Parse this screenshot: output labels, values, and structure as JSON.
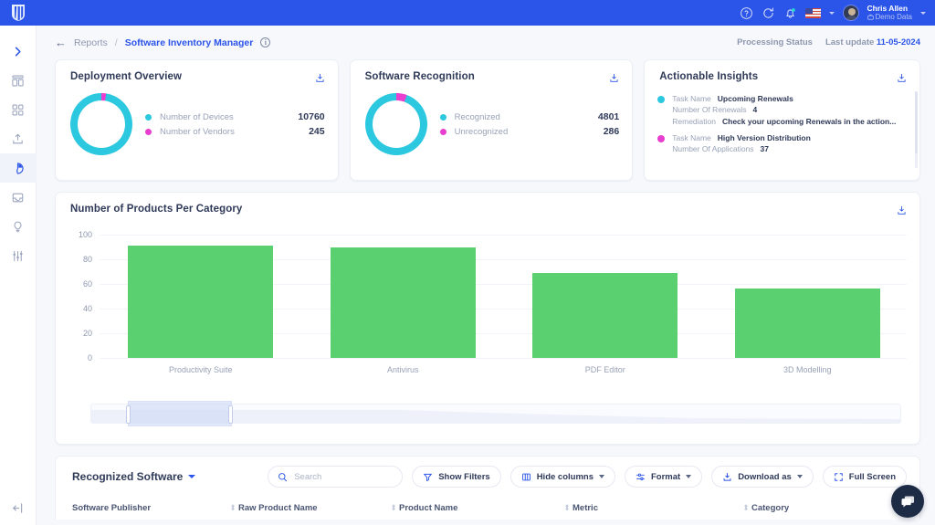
{
  "topbar": {
    "logo_name": "app-logo",
    "icons": [
      "help-icon",
      "history-icon",
      "notification-bell-icon"
    ],
    "flag": "us-flag",
    "user_name": "Chris Allen",
    "user_org": "Demo Data"
  },
  "rail": {
    "expand_label": "expand-sidebar",
    "items": [
      {
        "name": "sidebar-item-dashboard",
        "icon": "dashboard-icon"
      },
      {
        "name": "sidebar-item-apps",
        "icon": "grid-apps-icon"
      },
      {
        "name": "sidebar-item-upload",
        "icon": "upload-icon"
      },
      {
        "name": "sidebar-item-reports",
        "icon": "pie-chart-icon"
      },
      {
        "name": "sidebar-item-inbox",
        "icon": "inbox-icon"
      },
      {
        "name": "sidebar-item-insights",
        "icon": "lightbulb-icon"
      },
      {
        "name": "sidebar-item-settings",
        "icon": "sliders-icon"
      }
    ],
    "collapse": "collapse-sidebar-icon"
  },
  "breadcrumb": {
    "back": "←",
    "parent": "Reports",
    "separator": "/",
    "current": "Software Inventory Manager",
    "info": "i"
  },
  "status": {
    "processing": "Processing Status",
    "last_update_label": "Last update",
    "last_update_value": "11-05-2024"
  },
  "cards": {
    "deployment": {
      "title": "Deployment Overview",
      "download": "download-icon",
      "legend": [
        {
          "label": "Number of Devices",
          "value": "10760",
          "color": "#2cc8e0"
        },
        {
          "label": "Number of Vendors",
          "value": "245",
          "color": "#e83fd0"
        }
      ]
    },
    "recognition": {
      "title": "Software Recognition",
      "download": "download-icon",
      "legend": [
        {
          "label": "Recognized",
          "value": "4801",
          "color": "#2cc8e0"
        },
        {
          "label": "Unrecognized",
          "value": "286",
          "color": "#e83fd0"
        }
      ]
    },
    "insights": {
      "title": "Actionable Insights",
      "download": "download-icon",
      "items": [
        {
          "color": "#2cc8e0",
          "rows": [
            {
              "key": "Task Name",
              "value": "Upcoming Renewals"
            },
            {
              "key": "Number Of Renewals",
              "value": "4"
            },
            {
              "key": "Remediation",
              "value": "Check your upcoming Renewals in the action..."
            }
          ]
        },
        {
          "color": "#e83fd0",
          "rows": [
            {
              "key": "Task Name",
              "value": "High Version Distribution"
            },
            {
              "key": "Number Of Applications",
              "value": "37"
            }
          ]
        }
      ]
    }
  },
  "chart_data": {
    "type": "bar",
    "title": "Number of Products Per Category",
    "categories": [
      "Productivity Suite",
      "Antivirus",
      "PDF Editor",
      "3D Modelling"
    ],
    "values": [
      91,
      90,
      69,
      56
    ],
    "xlabel": "",
    "ylabel": "",
    "ylim": [
      0,
      100
    ],
    "yticks": [
      0,
      20,
      40,
      60,
      80,
      100
    ],
    "grid": true,
    "legend": "none",
    "bar_color": "#5bd071",
    "download": "download-icon"
  },
  "table": {
    "title": "Recognized Software",
    "search_placeholder": "Search",
    "search_value": "",
    "buttons": [
      {
        "name": "show-filters-button",
        "label": "Show Filters",
        "icon": "filter-icon",
        "caret": false
      },
      {
        "name": "hide-columns-button",
        "label": "Hide columns",
        "icon": "columns-icon",
        "caret": true
      },
      {
        "name": "format-button",
        "label": "Format",
        "icon": "sliders-icon",
        "caret": true
      },
      {
        "name": "download-as-button",
        "label": "Download as",
        "icon": "download-icon",
        "caret": true
      },
      {
        "name": "full-screen-button",
        "label": "Full Screen",
        "icon": "fullscreen-icon",
        "caret": false
      }
    ],
    "columns": [
      "Software Publisher",
      "Raw Product Name",
      "Product Name",
      "Metric",
      "Category"
    ]
  },
  "chat": {
    "icon": "chat-bubble-icon"
  }
}
